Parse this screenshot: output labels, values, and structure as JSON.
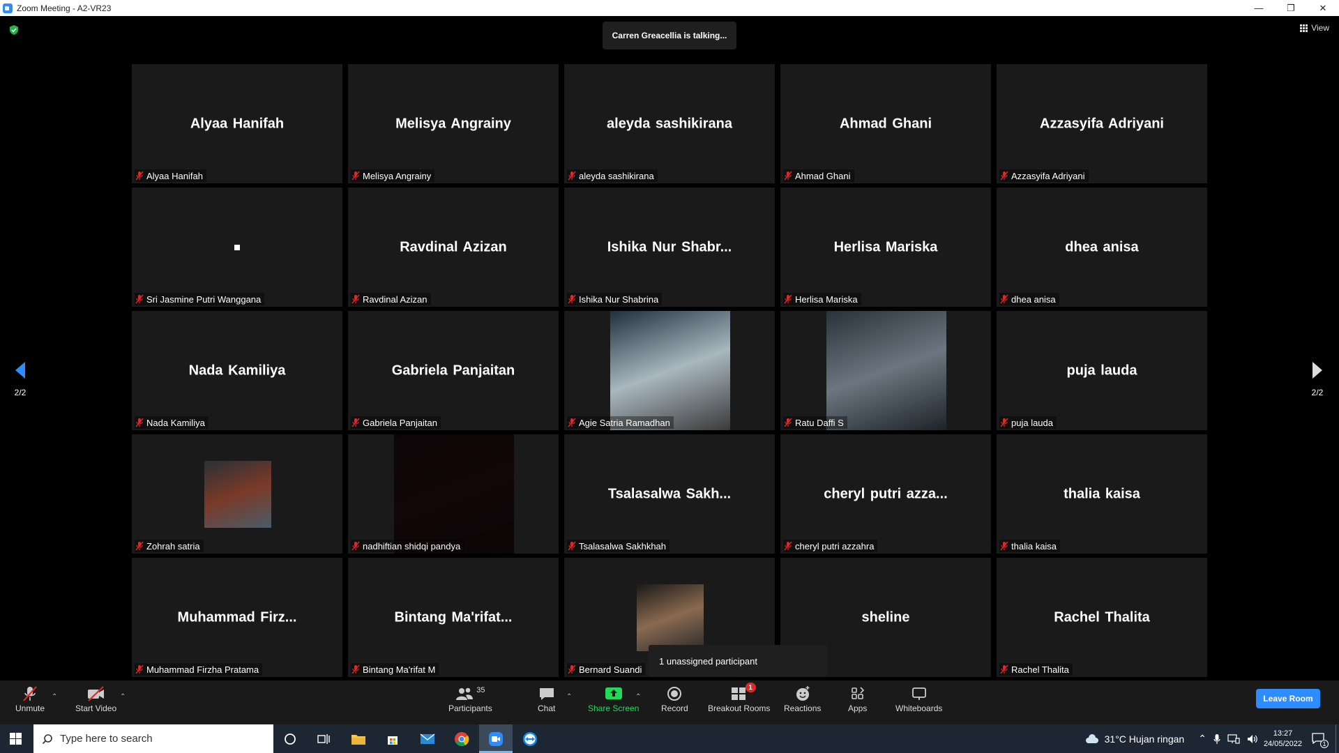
{
  "window": {
    "title": "Zoom Meeting - A2-VR23",
    "minimize": "—",
    "restore": "❐",
    "close": "✕"
  },
  "meeting": {
    "talking_banner": "Carren Greacellia is talking...",
    "view_label": "View",
    "page_indicator_left": "2/2",
    "page_indicator_right": "2/2",
    "unassigned_popup": "1 unassigned participant"
  },
  "tiles": [
    {
      "big": "Alyaa Hanifah",
      "label": "Alyaa Hanifah"
    },
    {
      "big": "Melisya Angrainy",
      "label": "Melisya Angrainy"
    },
    {
      "big": "aleyda sashikirana",
      "label": "aleyda sashikirana"
    },
    {
      "big": "Ahmad Ghani",
      "label": "Ahmad Ghani"
    },
    {
      "big": "Azzasyifa Adriyani",
      "label": "Azzasyifa Adriyani"
    },
    {
      "big": "",
      "label": "Sri Jasmine Putri Wanggana"
    },
    {
      "big": "Ravdinal Azizan",
      "label": "Ravdinal Azizan"
    },
    {
      "big": "Ishika Nur Shabr...",
      "label": "Ishika Nur Shabrina"
    },
    {
      "big": "Herlisa Mariska",
      "label": "Herlisa Mariska"
    },
    {
      "big": "dhea anisa",
      "label": "dhea anisa"
    },
    {
      "big": "Nada Kamiliya",
      "label": "Nada Kamiliya"
    },
    {
      "big": "Gabriela Panjaitan",
      "label": "Gabriela Panjaitan"
    },
    {
      "big": "",
      "label": "Agie Satria Ramadhan"
    },
    {
      "big": "",
      "label": "Ratu Daffi S"
    },
    {
      "big": "puja lauda",
      "label": "puja lauda"
    },
    {
      "big": "",
      "label": "Zohrah satria"
    },
    {
      "big": "",
      "label": "nadhiftian shidqi pandya"
    },
    {
      "big": "Tsalasalwa Sakh...",
      "label": "Tsalasalwa Sakhkhah"
    },
    {
      "big": "cheryl putri azza...",
      "label": "cheryl putri azzahra"
    },
    {
      "big": "thalia kaisa",
      "label": "thalia kaisa"
    },
    {
      "big": "Muhammad Firz...",
      "label": "Muhammad Firzha Pratama"
    },
    {
      "big": "Bintang Ma'rifat...",
      "label": "Bintang Ma'rifat M"
    },
    {
      "big": "",
      "label": "Bernard Suandi"
    },
    {
      "big": "sheline",
      "label": ""
    },
    {
      "big": "Rachel Thalita",
      "label": "Rachel Thalita"
    }
  ],
  "toolbar": {
    "unmute": "Unmute",
    "start_video": "Start Video",
    "participants": "Participants",
    "participants_count": "35",
    "chat": "Chat",
    "share_screen": "Share Screen",
    "record": "Record",
    "breakout_rooms": "Breakout Rooms",
    "breakout_badge": "1",
    "reactions": "Reactions",
    "apps": "Apps",
    "whiteboards": "Whiteboards",
    "leave": "Leave Room"
  },
  "taskbar": {
    "search_placeholder": "Type here to search",
    "weather": "31°C  Hujan ringan",
    "time": "13:27",
    "date": "24/05/2022",
    "notifications": "1"
  },
  "colors": {
    "accent": "#2d8cff",
    "share_green": "#23d959",
    "mute_red": "#e02828",
    "tile_bg": "#1a1a1a"
  }
}
